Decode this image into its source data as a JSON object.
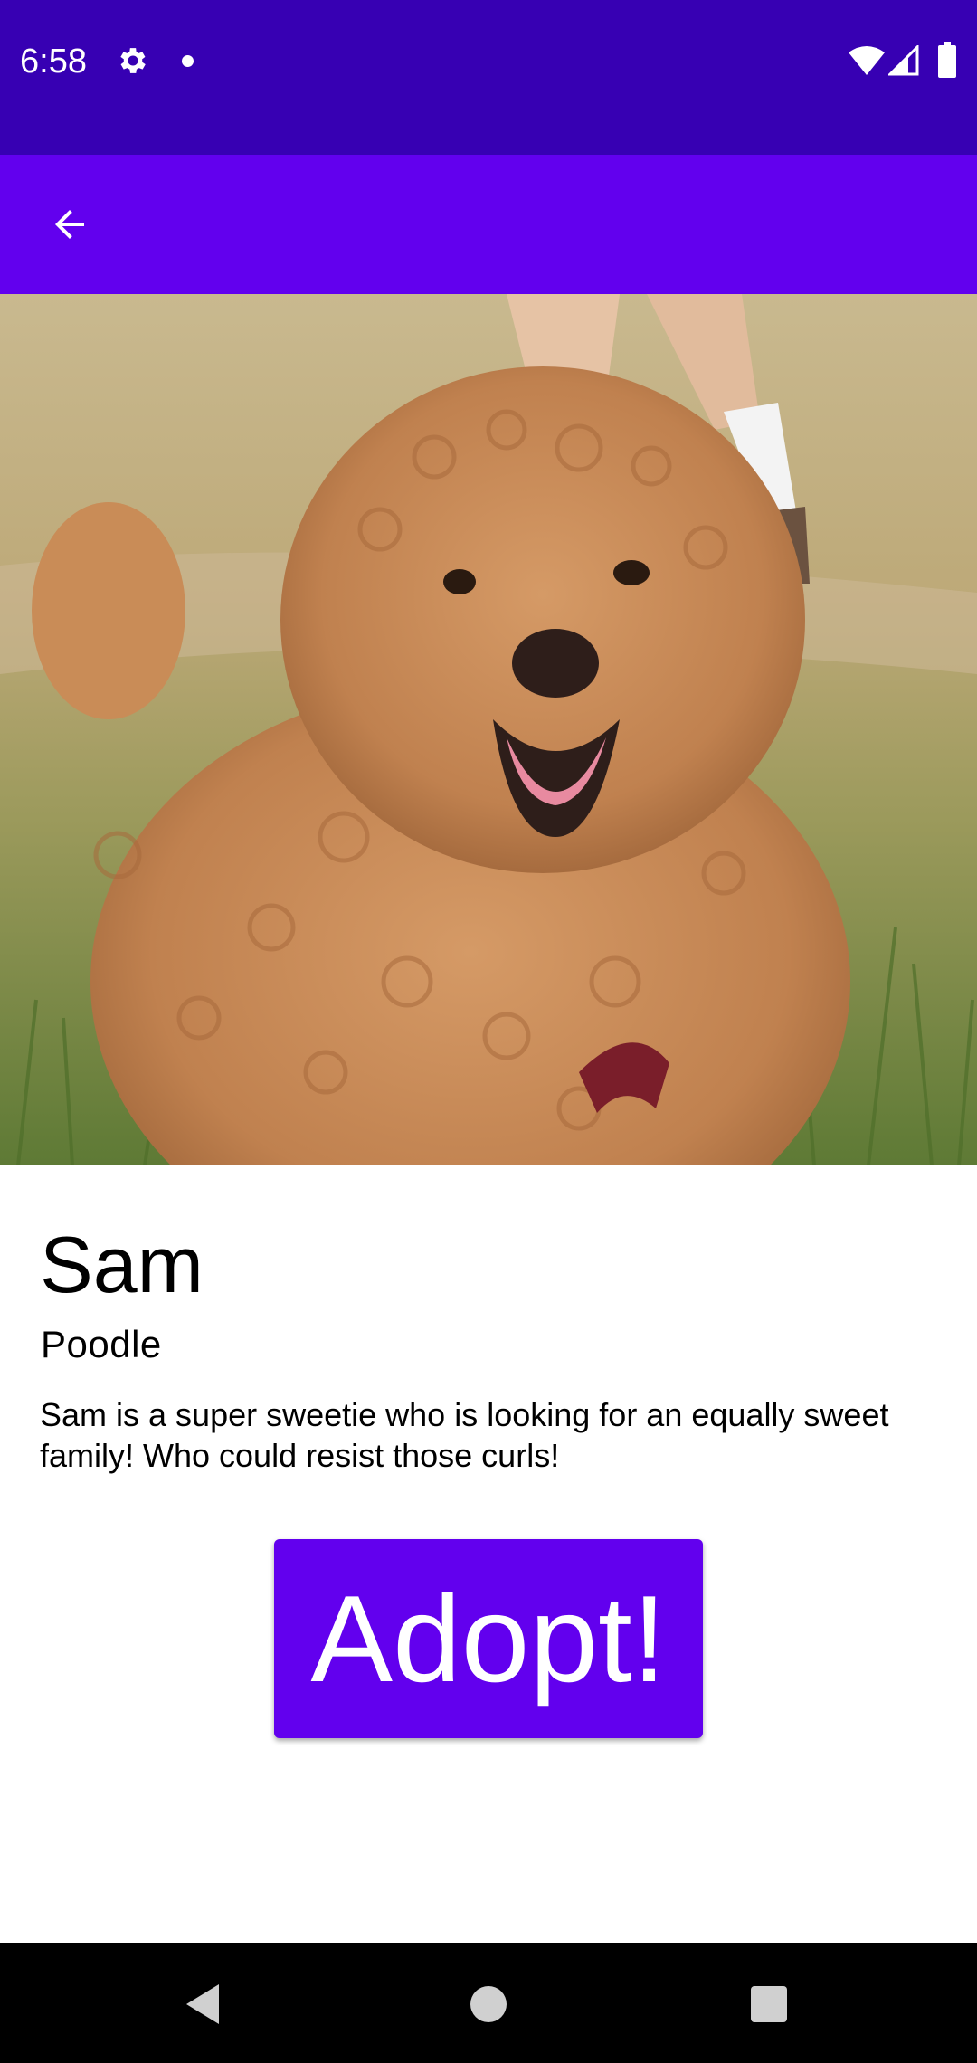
{
  "status_bar": {
    "time": "6:58",
    "icons": [
      "gear-icon",
      "notification-dot-icon",
      "wifi-icon",
      "cell-signal-icon",
      "battery-icon"
    ]
  },
  "app_bar": {
    "back_icon": "arrow-back-icon",
    "color": "#6200EE"
  },
  "status_bar_color": "#3700B3",
  "hero_image": {
    "subject": "dog-photo"
  },
  "pet": {
    "name": "Sam",
    "breed": "Poodle",
    "description": "Sam is a super sweetie who is looking for an equally sweet family! Who could resist those curls!"
  },
  "adopt_button": {
    "label": "Adopt!",
    "color": "#6200EE"
  },
  "nav_bar": {
    "icons": [
      "nav-back-icon",
      "nav-home-icon",
      "nav-recents-icon"
    ]
  }
}
